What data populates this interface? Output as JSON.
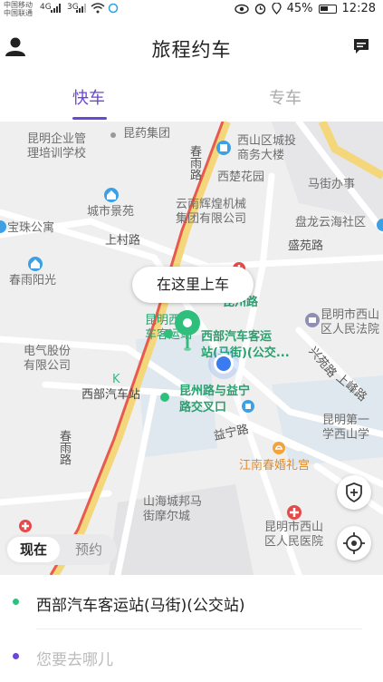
{
  "status_bar": {
    "carrier_1": "中国移动",
    "carrier_2": "中国联通",
    "net_1": "4G",
    "net_2": "3G",
    "battery": "45%",
    "time": "12:28"
  },
  "header": {
    "title": "旅程约车",
    "user_icon": "user-icon",
    "message_icon": "message-icon"
  },
  "tabs": [
    {
      "label": "快车",
      "active": true
    },
    {
      "label": "专车",
      "active": false
    }
  ],
  "map": {
    "pickup_prompt": "在这里上车",
    "labels": {
      "kunming_enterprise_1": "昆明企业管",
      "kunming_enterprise_2": "理培训学校",
      "kunyao_group": "昆药集团",
      "xishan_invest_1": "西山区城投",
      "xishan_invest_2": "商务大楼",
      "chunyu_road_top": "春雨路",
      "xichu_garden": "西楚花园",
      "majie_office": "马街办事",
      "chengshi_jingyuan": "城市景苑",
      "yunnan_huihuang_1": "云南辉煌机械",
      "yunnan_huihuang_2": "集团有限公司",
      "panlong_community": "盘龙云海社区",
      "baozhu_apt": "宝珠公寓",
      "shangcun_road": "上村路",
      "shengyuan_road": "盛苑路",
      "chunyu_yangguang": "春雨阳光",
      "kunzhou_road": "昆州路",
      "kunming_west_1": "昆明西",
      "kunming_west_2": "车客运站",
      "court_1": "昆明市西山",
      "court_2": "区人民法院",
      "station_1": "西部汽车客运",
      "station_2": "站(马街)(公交...",
      "electric_1": "电气股份",
      "electric_2": "有限公司",
      "xingyuan_road": "兴苑路",
      "shangfeng_road": "上峰路",
      "xibu_station": "西部汽车站",
      "cross_1": "昆州路与益宁",
      "cross_2": "路交叉口",
      "yining_road": "益宁路",
      "school_1": "昆明第一",
      "school_2": "学西山学",
      "jiangnan_wedding": "江南春婚礼宫",
      "chunyu_road_bottom": "春雨路",
      "shanhai_1": "山海城邦马",
      "shanhai_2": "街摩尔城",
      "hospital_1": "昆明市西山",
      "hospital_2": "区人民医院"
    }
  },
  "time_toggle": {
    "now": "现在",
    "book": "预约"
  },
  "trip": {
    "from": "西部汽车客运站(马街)(公交站)",
    "to_placeholder": "您要去哪儿"
  },
  "colors": {
    "accent": "#6b47d6",
    "pin_green": "#2fbf7d",
    "user_blue": "#3a7bf0"
  }
}
